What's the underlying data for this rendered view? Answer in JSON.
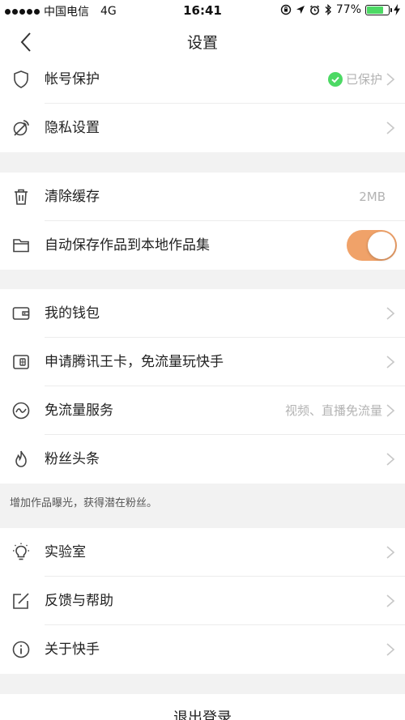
{
  "status_bar": {
    "carrier": "中国电信",
    "network": "4G",
    "time": "16:41",
    "battery_percent": "77%",
    "battery_level": 0.77
  },
  "nav": {
    "title": "设置"
  },
  "groups": {
    "account": [
      {
        "label": "帐号保护",
        "value": "已保护",
        "icon": "shield-icon"
      },
      {
        "label": "隐私设置",
        "value": "",
        "icon": "privacy-satellite-icon"
      }
    ],
    "storage": [
      {
        "label": "清除缓存",
        "value": "2MB",
        "icon": "trash-icon"
      },
      {
        "label": "自动保存作品到本地作品集",
        "icon": "folder-icon",
        "toggle_on": true
      }
    ],
    "services": [
      {
        "label": "我的钱包",
        "value": "",
        "icon": "wallet-icon"
      },
      {
        "label": "申请腾讯王卡，免流量玩快手",
        "value": "",
        "icon": "sim-card-icon"
      },
      {
        "label": "免流量服务",
        "value": "视频、直播免流量",
        "icon": "traffic-wave-icon"
      },
      {
        "label": "粉丝头条",
        "value": "",
        "icon": "flame-icon"
      }
    ],
    "services_hint": "增加作品曝光，获得潜在粉丝。",
    "misc": [
      {
        "label": "实验室",
        "value": "",
        "icon": "lightbulb-icon"
      },
      {
        "label": "反馈与帮助",
        "value": "",
        "icon": "edit-icon"
      },
      {
        "label": "关于快手",
        "value": "",
        "icon": "info-icon"
      }
    ]
  },
  "logout_label": "退出登录",
  "colors": {
    "toggle_on": "#f0a269",
    "protected_check": "#4cd964",
    "secondary_text": "#b3b3b3",
    "page_background": "#f2f2f2"
  }
}
